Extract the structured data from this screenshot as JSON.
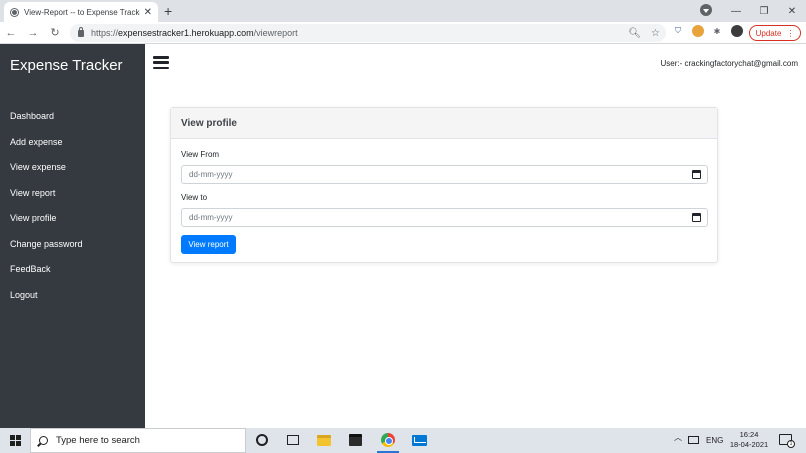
{
  "browser": {
    "tab_title": "View-Report -- to Expense Tracker",
    "tab_close": "✕",
    "new_tab": "+",
    "url_scheme": "https://",
    "url_host": "expensestracker1.herokuapp.com",
    "url_path": "/viewreport",
    "update_label": "Update",
    "window_controls": {
      "minimize": "—",
      "restore": "❐",
      "close": "✕"
    },
    "nav": {
      "back": "←",
      "forward": "→",
      "reload": "↻"
    },
    "icons": [
      "search-icon",
      "star-icon",
      "shield-extension-icon",
      "cookie-extension-icon",
      "puzzle-icon",
      "profile-avatar"
    ]
  },
  "app": {
    "brand": "Expense Tracker",
    "user": "User:- crackingfactorychat@gmail.com",
    "nav": [
      {
        "label": "Dashboard"
      },
      {
        "label": "Add expense"
      },
      {
        "label": "View expense"
      },
      {
        "label": "View report"
      },
      {
        "label": "View profile"
      },
      {
        "label": "Change password"
      },
      {
        "label": "FeedBack"
      },
      {
        "label": "Logout"
      }
    ]
  },
  "card": {
    "title": "View profile",
    "from_label": "View From",
    "from_placeholder": "dd-mm-yyyy",
    "to_label": "View to",
    "to_placeholder": "dd-mm-yyyy",
    "submit_label": "View report"
  },
  "taskbar": {
    "search_placeholder": "Type here to search",
    "lang": "ENG",
    "time": "16:24",
    "date": "18-04-2021",
    "notification_count": "1"
  },
  "colors": {
    "sidebar": "#343a40",
    "primary": "#007bff",
    "update": "#d93025"
  }
}
